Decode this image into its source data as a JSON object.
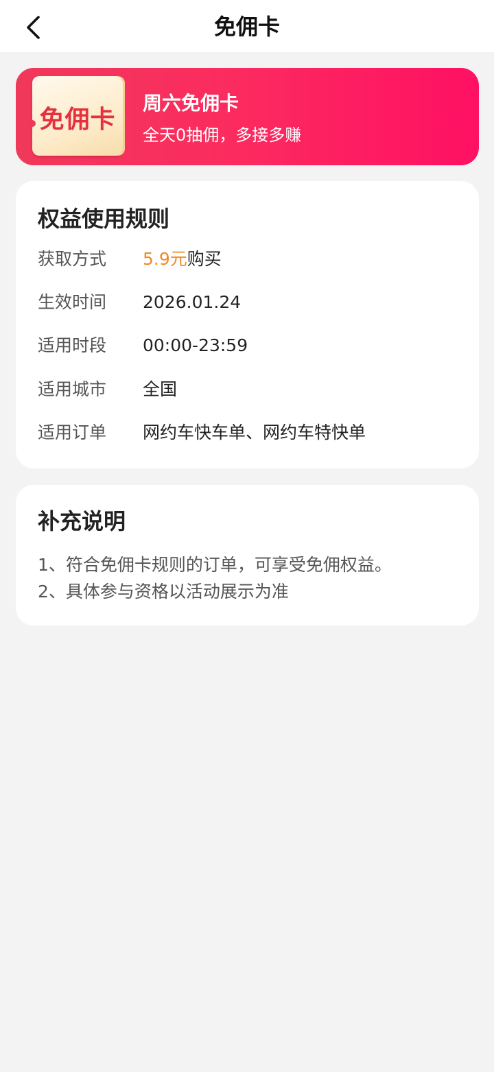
{
  "header": {
    "title": "免佣卡",
    "back_icon": "chevron-left-icon"
  },
  "banner": {
    "ticket_label": "免佣卡",
    "title": "周六免佣卡",
    "subtitle": "全天0抽佣，多接多赚",
    "colors": {
      "gradient_start": "#f0385a",
      "gradient_end": "#ff1063",
      "ticket_text": "#e5303f"
    }
  },
  "rules": {
    "title": "权益使用规则",
    "acquire": {
      "label": "获取方式",
      "price": "5.9元",
      "suffix": "购买"
    },
    "effective_time": {
      "label": "生效时间",
      "value": "2026.01.24"
    },
    "time_period": {
      "label": "适用时段",
      "value": "00:00-23:59"
    },
    "city": {
      "label": "适用城市",
      "value": "全国"
    },
    "orders": {
      "label": "适用订单",
      "value": "网约车快车单、网约车特快单"
    },
    "price_color": "#f08a24"
  },
  "notes": {
    "title": "补充说明",
    "items": [
      "1、符合免佣卡规则的订单，可享受免佣权益。",
      "2、具体参与资格以活动展示为准"
    ]
  }
}
